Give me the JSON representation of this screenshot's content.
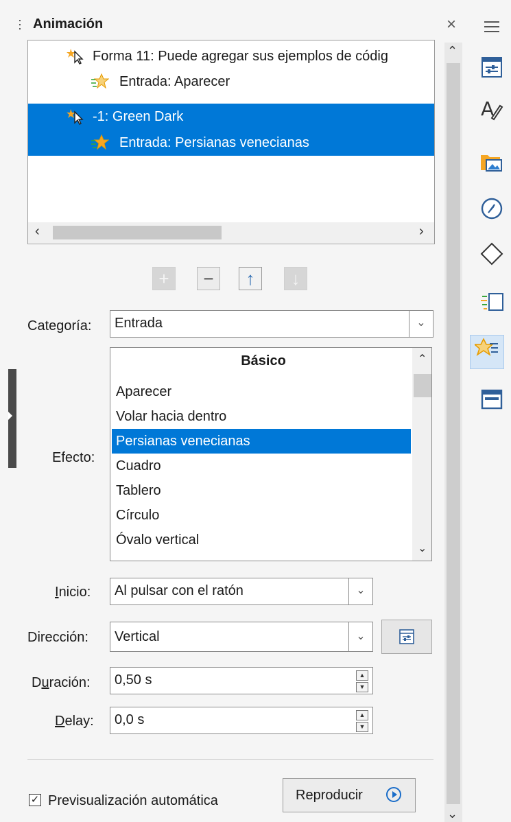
{
  "panel": {
    "title": "Animación",
    "close_glyph": "×"
  },
  "tree": {
    "items": [
      {
        "text": "Forma 11: Puede agregar sus ejemplos de códig",
        "icon": "pointer-star-icon",
        "selected": false
      },
      {
        "text": "Entrada: Aparecer",
        "icon": "entrance-star-icon",
        "selected": false
      },
      {
        "text": "-1: Green Dark",
        "icon": "pointer-star-icon",
        "selected": true
      },
      {
        "text": "Entrada: Persianas venecianas",
        "icon": "entrance-star-icon",
        "selected": true
      }
    ]
  },
  "toolbar": {
    "add_glyph": "+",
    "remove_glyph": "−",
    "up_glyph": "↑",
    "down_glyph": "↓"
  },
  "category": {
    "label": "Categoría:",
    "value": "Entrada"
  },
  "effect": {
    "label": "Efecto:",
    "group_header": "Básico",
    "items": [
      "Aparecer",
      "Volar hacia dentro",
      "Persianas venecianas",
      "Cuadro",
      "Tablero",
      "Círculo",
      "Óvalo vertical"
    ],
    "selected": "Persianas venecianas"
  },
  "start": {
    "label_accel": "I",
    "label_rest": "nicio:",
    "value": "Al pulsar con el ratón"
  },
  "direction": {
    "label": "Dirección:",
    "value": "Vertical"
  },
  "duration": {
    "label_pre": "D",
    "label_accel": "u",
    "label_rest": "ración:",
    "value": "0,50 s"
  },
  "delay": {
    "label_accel": "D",
    "label_rest": "elay:",
    "value": "0,0 s"
  },
  "autopreview": {
    "label": "Previsualización automática",
    "checked": true
  },
  "play": {
    "label": "Reproducir"
  },
  "sidebar_deck": {
    "icons": [
      "properties-icon",
      "styles-icon",
      "gallery-icon",
      "navigator-icon",
      "shapes-icon",
      "slide-transition-icon",
      "animation-icon",
      "master-slides-icon"
    ],
    "active": "animation-icon"
  },
  "colors": {
    "selection": "#0078d7",
    "accent_orange": "#f5a623"
  }
}
